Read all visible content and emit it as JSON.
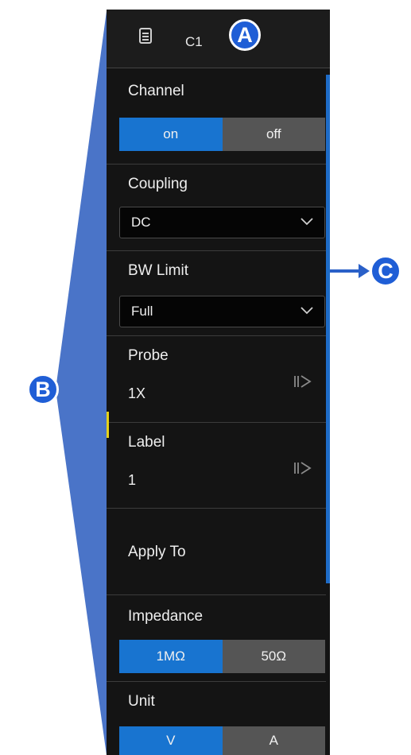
{
  "header": {
    "title": "C1",
    "icon": "document-icon"
  },
  "callouts": {
    "a": "A",
    "b": "B",
    "c": "C"
  },
  "channel": {
    "label": "Channel",
    "options": [
      "on",
      "off"
    ],
    "selected": "on"
  },
  "coupling": {
    "label": "Coupling",
    "value": "DC"
  },
  "bw_limit": {
    "label": "BW Limit",
    "value": "Full"
  },
  "probe": {
    "label": "Probe",
    "value": "1X"
  },
  "label_item": {
    "label": "Label",
    "value": "1"
  },
  "apply_to": {
    "label": "Apply To"
  },
  "impedance": {
    "label": "Impedance",
    "options": [
      "1MΩ",
      "50Ω"
    ],
    "selected": "1MΩ"
  },
  "unit": {
    "label": "Unit",
    "options": [
      "V",
      "A"
    ],
    "selected": "V"
  },
  "colors": {
    "accent": "#1874d0",
    "callout": "#1f5ed6",
    "panel_bg": "#141414",
    "unselected": "#555555"
  }
}
